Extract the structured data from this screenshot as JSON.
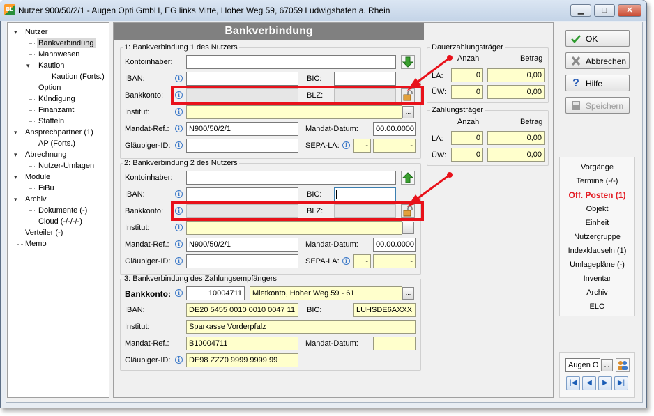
{
  "window": {
    "title": "Nutzer 900/50/2/1 - Augen Opti GmbH, EG links Mitte, Hoher Weg 59, 67059 Ludwigshafen a. Rhein",
    "app_icon_text": "BL"
  },
  "tree": [
    {
      "label": "Nutzer"
    },
    {
      "label": "Bankverbindung"
    },
    {
      "label": "Mahnwesen"
    },
    {
      "label": "Kaution"
    },
    {
      "label": "Kaution (Forts.)"
    },
    {
      "label": "Option"
    },
    {
      "label": "Kündigung"
    },
    {
      "label": "Finanzamt"
    },
    {
      "label": "Staffeln"
    },
    {
      "label": "Ansprechpartner (1)"
    },
    {
      "label": "AP (Forts.)"
    },
    {
      "label": "Abrechnung"
    },
    {
      "label": "Nutzer-Umlagen"
    },
    {
      "label": "Module"
    },
    {
      "label": "FiBu"
    },
    {
      "label": "Archiv"
    },
    {
      "label": "Dokumente (-)"
    },
    {
      "label": "Cloud (-/-/-/-)"
    },
    {
      "label": "Verteiler (-)"
    },
    {
      "label": "Memo"
    }
  ],
  "header": {
    "title": "Bankverbindung"
  },
  "bv1": {
    "group_title": "1: Bankverbindung 1 des Nutzers",
    "kontoinhaber_label": "Kontoinhaber:",
    "kontoinhaber": "",
    "iban_label": "IBAN:",
    "iban": "",
    "bic_label": "BIC:",
    "bic": "",
    "bankkonto_label": "Bankkonto:",
    "bankkonto": "",
    "blz_label": "BLZ:",
    "blz": "",
    "institut_label": "Institut:",
    "institut": "",
    "mandat_ref_label": "Mandat-Ref.:",
    "mandat_ref": "N900/50/2/1",
    "mandat_datum_label": "Mandat-Datum:",
    "mandat_datum": "00.00.0000",
    "glaeubiger_label": "Gläubiger-ID:",
    "glaeubiger": "",
    "sepa_label": "SEPA-LA:",
    "sepa_a": "-",
    "sepa_b": "-"
  },
  "bv2": {
    "group_title": "2: Bankverbindung 2 des Nutzers",
    "kontoinhaber_label": "Kontoinhaber:",
    "kontoinhaber": "",
    "iban_label": "IBAN:",
    "iban": "",
    "bic_label": "BIC:",
    "bic": "",
    "bankkonto_label": "Bankkonto:",
    "bankkonto": "",
    "blz_label": "BLZ:",
    "blz": "",
    "institut_label": "Institut:",
    "institut": "",
    "mandat_ref_label": "Mandat-Ref.:",
    "mandat_ref": "N900/50/2/1",
    "mandat_datum_label": "Mandat-Datum:",
    "mandat_datum": "00.00.0000",
    "glaeubiger_label": "Gläubiger-ID:",
    "glaeubiger": "",
    "sepa_label": "SEPA-LA:",
    "sepa_a": "-",
    "sepa_b": "-"
  },
  "bv3": {
    "group_title": "3: Bankverbindung des Zahlungsempfängers",
    "bankkonto_label": "Bankkonto:",
    "bankkonto": "10004711",
    "bankkonto_desc": "Mietkonto,  Hoher Weg 59 - 61",
    "iban_label": "IBAN:",
    "iban": "DE20 5455 0010 0010 0047 11",
    "bic_label": "BIC:",
    "bic": "LUHSDE6AXXX",
    "institut_label": "Institut:",
    "institut": "Sparkasse Vorderpfalz",
    "mandat_ref_label": "Mandat-Ref.:",
    "mandat_ref": "B10004711",
    "mandat_datum_label": "Mandat-Datum:",
    "mandat_datum": "",
    "glaeubiger_label": "Gläubiger-ID:",
    "glaeubiger": "DE98 ZZZ0 9999 9999 99"
  },
  "dauer": {
    "group_title": "Dauerzahlungsträger",
    "anzahl_label": "Anzahl",
    "betrag_label": "Betrag",
    "la_label": "LA:",
    "la_anzahl": "0",
    "la_betrag": "0,00",
    "uw_label": "ÜW:",
    "uw_anzahl": "0",
    "uw_betrag": "0,00"
  },
  "zahl": {
    "group_title": "Zahlungsträger",
    "anzahl_label": "Anzahl",
    "betrag_label": "Betrag",
    "la_label": "LA:",
    "la_anzahl": "0",
    "la_betrag": "0,00",
    "uw_label": "ÜW:",
    "uw_anzahl": "0",
    "uw_betrag": "0,00"
  },
  "buttons": {
    "ok": "OK",
    "abbrechen": "Abbrechen",
    "hilfe": "Hilfe",
    "speichern": "Speichern"
  },
  "nav": [
    {
      "label": "Vorgänge"
    },
    {
      "label": "Termine (-/-)"
    },
    {
      "label": "Off. Posten (1)"
    },
    {
      "label": "Objekt"
    },
    {
      "label": "Einheit"
    },
    {
      "label": "Nutzergruppe"
    },
    {
      "label": "Indexklauseln (1)"
    },
    {
      "label": "Umlagepläne (-)"
    },
    {
      "label": "Inventar"
    },
    {
      "label": "Archiv"
    },
    {
      "label": "ELO"
    }
  ],
  "record_selector": {
    "value": "Augen O",
    "dots": "..."
  },
  "colors": {
    "highlight_red": "#e8111a",
    "active_nav": "#e31b23",
    "header_gray": "#808080",
    "readonly_yellow": "#ffffcc"
  }
}
